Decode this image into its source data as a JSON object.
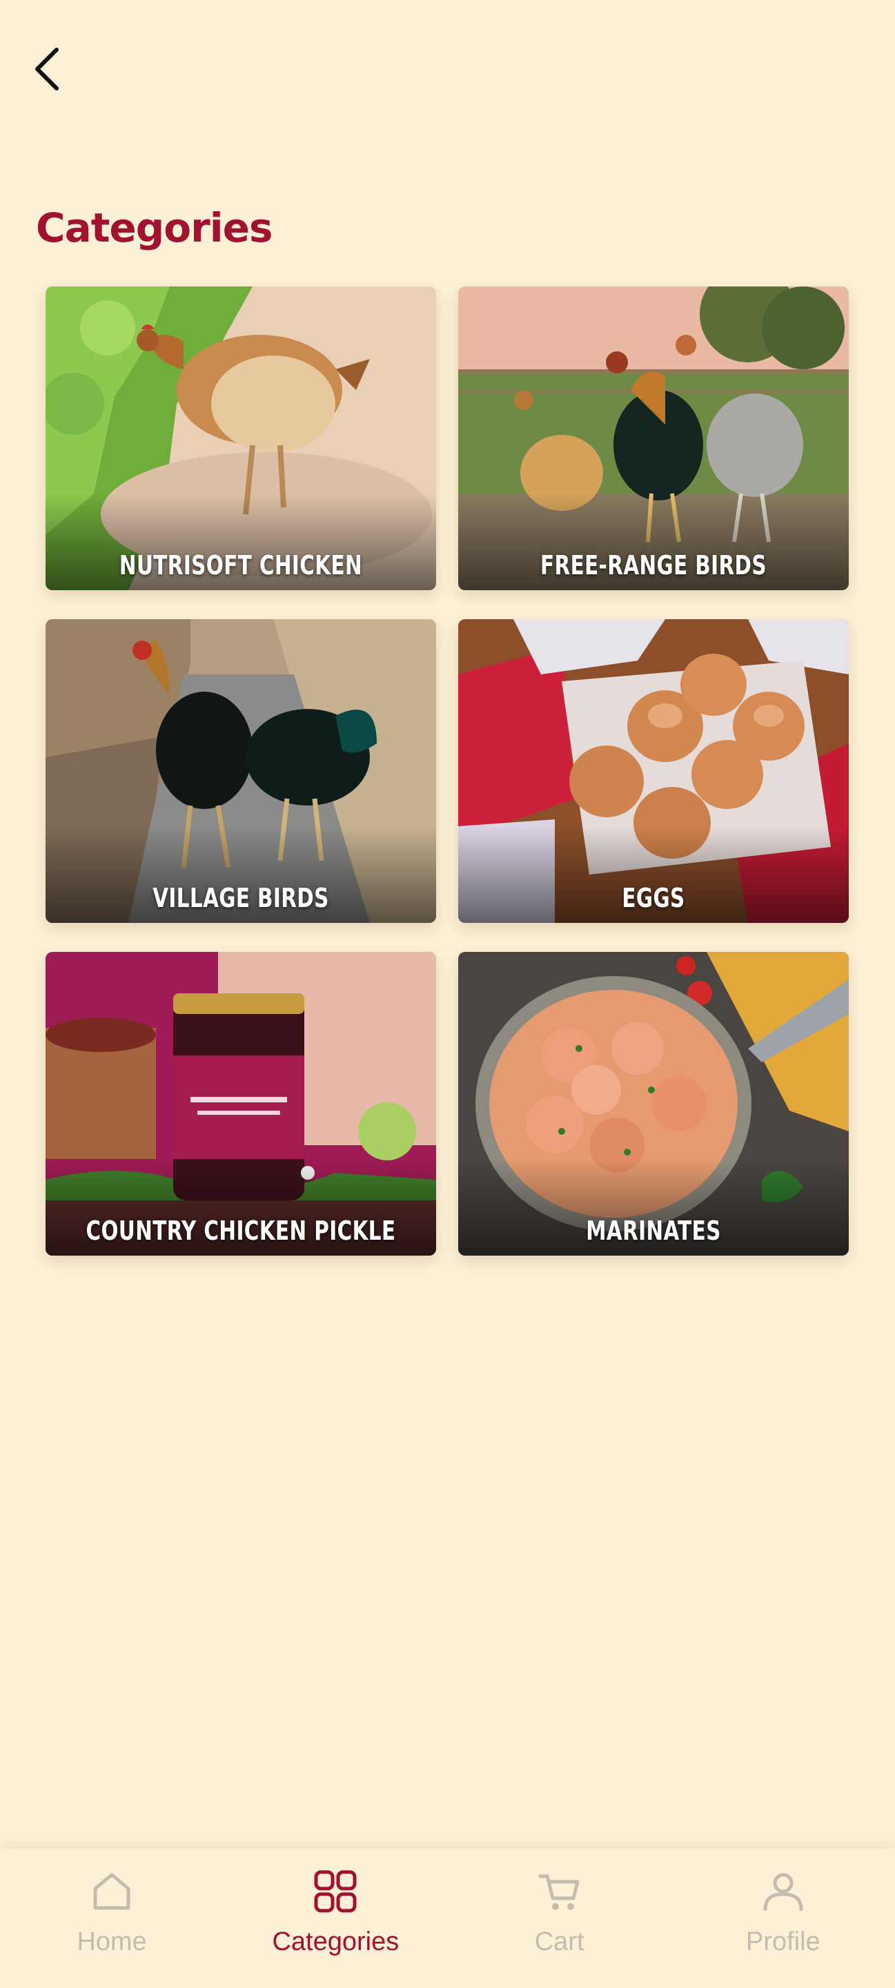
{
  "header": {
    "back_icon": "chevron-left-icon"
  },
  "page": {
    "title": "Categories"
  },
  "categories": [
    {
      "label": "NUTRISOFT CHICKEN"
    },
    {
      "label": "FREE-RANGE BIRDS"
    },
    {
      "label": "VILLAGE BIRDS"
    },
    {
      "label": "EGGS"
    },
    {
      "label": "COUNTRY CHICKEN PICKLE"
    },
    {
      "label": "MARINATES"
    }
  ],
  "bottom_nav": {
    "active": "Categories",
    "items": [
      {
        "label": "Home",
        "icon": "home-icon"
      },
      {
        "label": "Categories",
        "icon": "grid-icon"
      },
      {
        "label": "Cart",
        "icon": "cart-icon"
      },
      {
        "label": "Profile",
        "icon": "user-icon"
      }
    ]
  },
  "colors": {
    "background": "#fcf1d6",
    "accent": "#a0122f",
    "inactive_nav": "#c3bdb0"
  }
}
